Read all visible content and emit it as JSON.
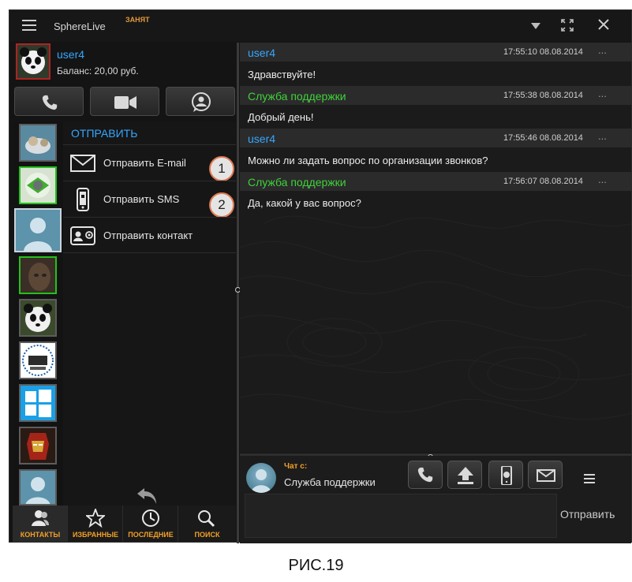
{
  "window": {
    "app_title": "SphereLive",
    "status": "ЗАНЯТ",
    "controls": [
      "dropdown-icon",
      "fullscreen-icon",
      "close-icon"
    ]
  },
  "profile": {
    "name": "user4",
    "balance": "Баланс: 20,00 руб."
  },
  "send_panel": {
    "title": "ОТПРАВИТЬ",
    "items": [
      {
        "label": "Отправить E-mail",
        "icon": "envelope-icon",
        "badge": "1"
      },
      {
        "label": "Отправить SMS",
        "icon": "phone-android-icon",
        "badge": "2"
      },
      {
        "label": "Отправить контакт",
        "icon": "contact-card-icon"
      }
    ]
  },
  "bottom_tabs": [
    {
      "label": "КОНТАКТЫ",
      "icon": "contacts-icon",
      "active": true
    },
    {
      "label": "ИЗБРАННЫЕ",
      "icon": "star-icon",
      "active": false
    },
    {
      "label": "ПОСЛЕДНИЕ",
      "icon": "clock-icon",
      "active": false
    },
    {
      "label": "ПОИСК",
      "icon": "search-icon",
      "active": false
    }
  ],
  "messages": [
    {
      "sender": "user4",
      "time": "17:55:10  08.08.2014",
      "text": "Здравствуйте!",
      "color": "#35a7ff"
    },
    {
      "sender": "Служба поддержки",
      "time": "17:55:38  08.08.2014",
      "text": "Добрый день!",
      "color": "#3fd23a"
    },
    {
      "sender": "user4",
      "time": "17:55:46  08.08.2014",
      "text": "Можно ли задать вопрос по организации звонков?",
      "color": "#35a7ff"
    },
    {
      "sender": "Служба поддержки",
      "time": "17:56:07  08.08.2014",
      "text": "Да,  какой у вас вопрос?",
      "color": "#3fd23a"
    }
  ],
  "compose": {
    "chat_with_label": "Чат с:",
    "chat_with_name": "Служба поддержки",
    "send_label": "Отправить",
    "input_value": ""
  },
  "more_glyph": "...",
  "caption": "РИС.19",
  "colors": {
    "accent_blue": "#35a7ff",
    "accent_green": "#3fd23a",
    "accent_orange": "#f2a029",
    "online_border": "#22c21a"
  }
}
